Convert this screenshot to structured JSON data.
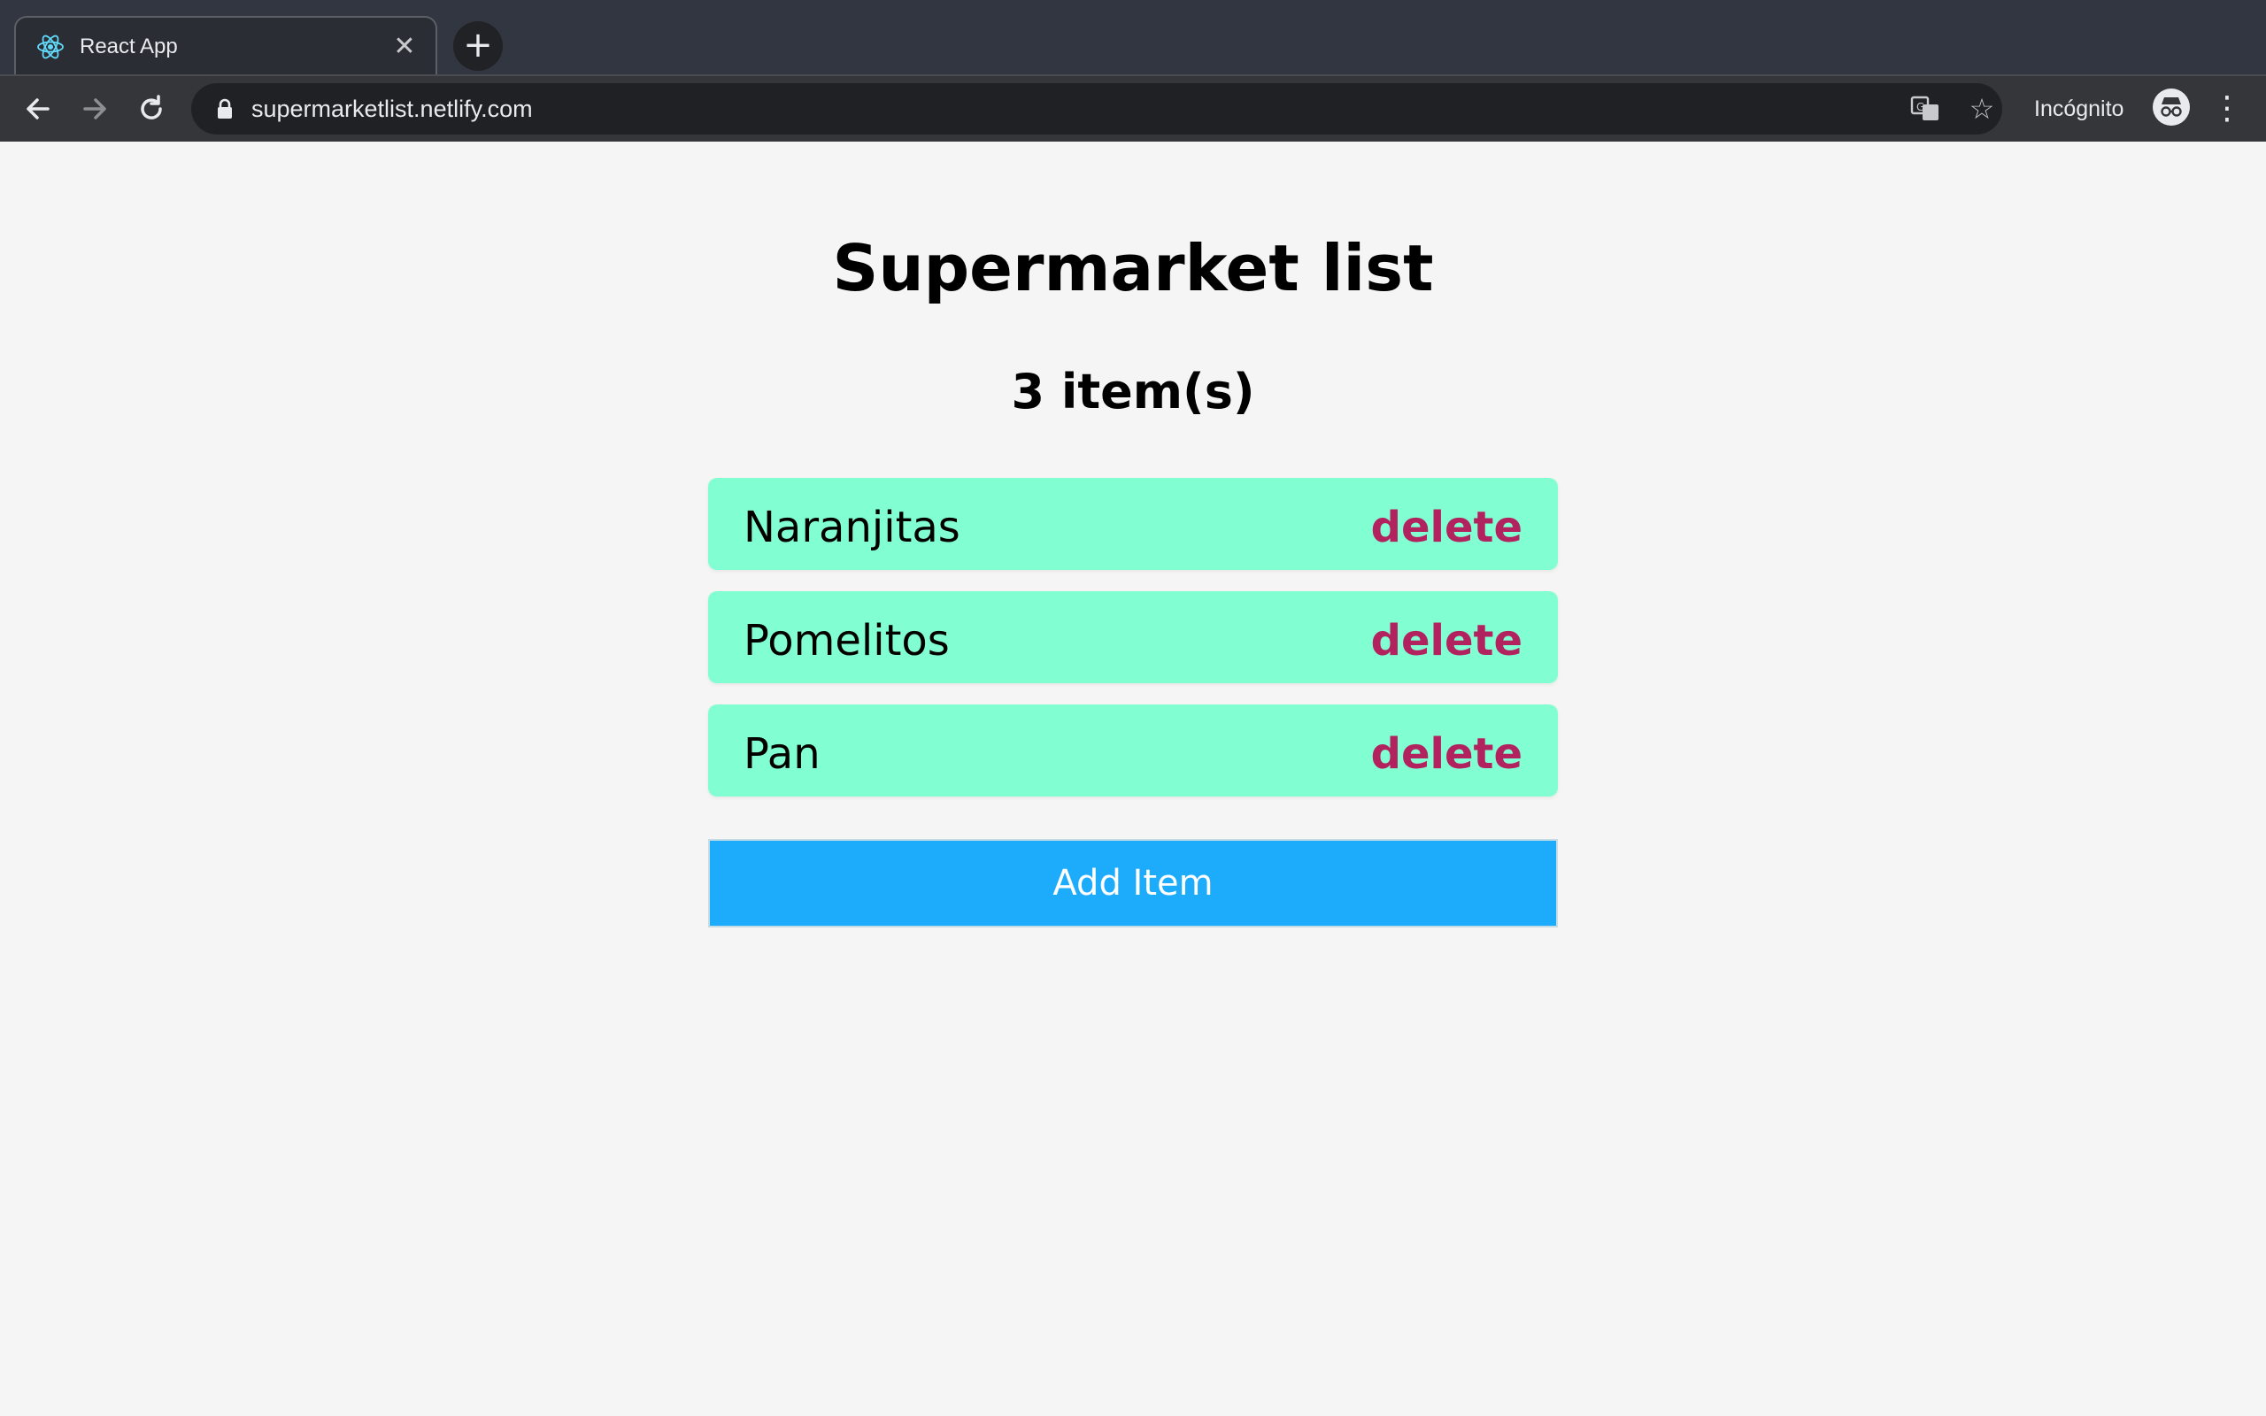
{
  "browser": {
    "tab_title": "React App",
    "tab_favicon": "react-atom-icon",
    "url": "supermarketlist.netlify.com",
    "profile_label": "Incógnito",
    "colors": {
      "frame": "#323641",
      "toolbar": "#35363a",
      "omnibox": "#202124"
    }
  },
  "page": {
    "title": "Supermarket list",
    "item_count_label": "3 item(s)",
    "items": [
      {
        "name": "Naranjitas",
        "delete_label": "delete"
      },
      {
        "name": "Pomelitos",
        "delete_label": "delete"
      },
      {
        "name": "Pan",
        "delete_label": "delete"
      }
    ],
    "add_button_label": "Add Item",
    "colors": {
      "background": "#f5f5f5",
      "item_background": "#82ffd2",
      "delete_text": "#b2225e",
      "add_button": "#1dabfc"
    }
  }
}
